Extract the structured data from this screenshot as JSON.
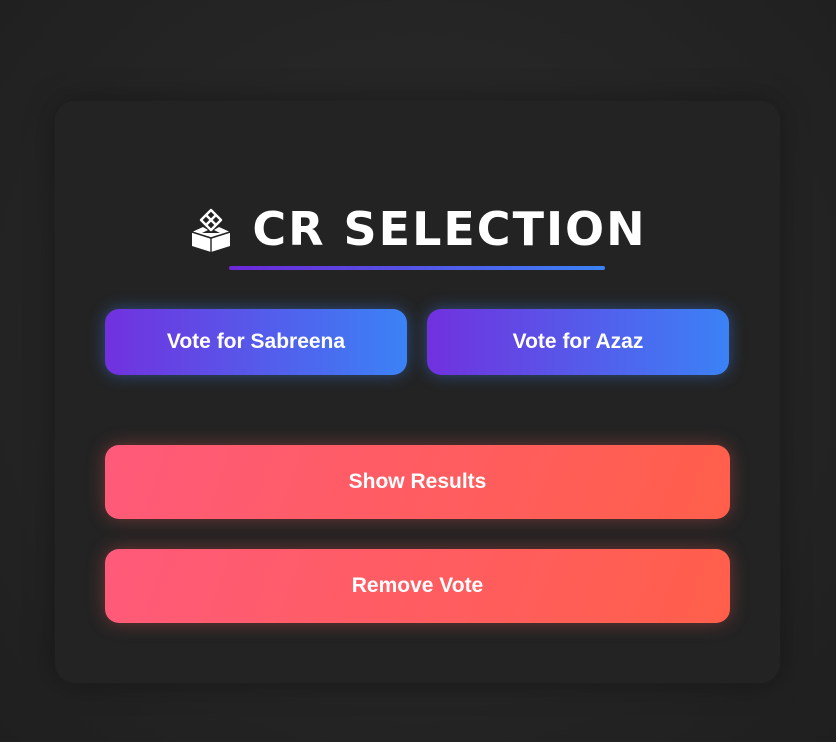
{
  "header": {
    "title": "CR SELECTION",
    "icon": "ballot-box-icon"
  },
  "vote_buttons": [
    {
      "label": "Vote for Sabreena"
    },
    {
      "label": "Vote for Azaz"
    }
  ],
  "actions": {
    "show_results": "Show Results",
    "remove_vote": "Remove Vote"
  },
  "colors": {
    "background": "#252525",
    "card": "#232323",
    "vote_gradient_start": "#7131de",
    "vote_gradient_end": "#3b82f6",
    "action_gradient_start": "#ff5a7a",
    "action_gradient_end": "#ff5f4a",
    "text": "#ffffff"
  }
}
